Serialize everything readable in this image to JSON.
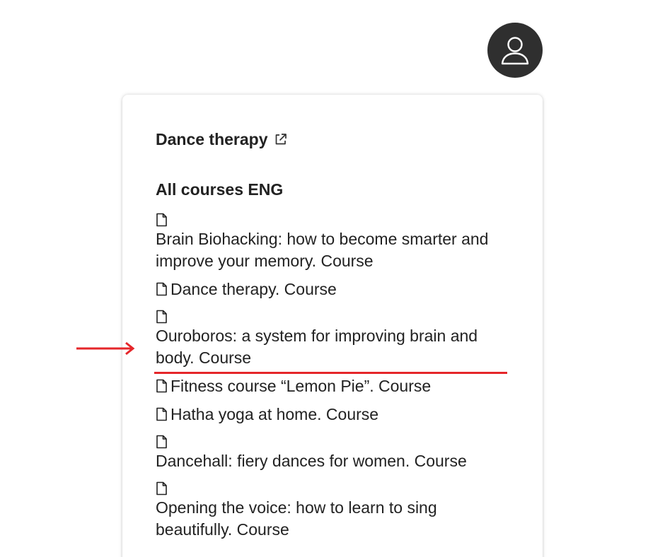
{
  "header": {
    "avatar_icon": "user-avatar-icon"
  },
  "panel": {
    "title": "Dance therapy",
    "title_icon": "external-link-icon",
    "section_heading": "All courses ENG",
    "courses": [
      {
        "label": "Brain Biohacking: how to become smarter and improve your memory. Course",
        "icon": "document-icon",
        "icon_on_own_line": true
      },
      {
        "label": "Dance therapy. Course",
        "icon": "document-icon",
        "icon_on_own_line": false
      },
      {
        "label": "Ouroboros: a system for improving brain and body. Course",
        "icon": "document-icon",
        "icon_on_own_line": true,
        "highlighted": true
      },
      {
        "label": "Fitness course “Lemon Pie”. Course",
        "icon": "document-icon",
        "icon_on_own_line": false
      },
      {
        "label": "Hatha yoga at home. Course",
        "icon": "document-icon",
        "icon_on_own_line": false
      },
      {
        "label": "Dancehall: fiery dances for women. Course",
        "icon": "document-icon",
        "icon_on_own_line": true
      },
      {
        "label": "Opening the voice: how to learn to sing beautifully. Course",
        "icon": "document-icon",
        "icon_on_own_line": true
      }
    ]
  },
  "annotation": {
    "color": "#e5262a",
    "arrow_icon": "right-arrow-icon"
  }
}
